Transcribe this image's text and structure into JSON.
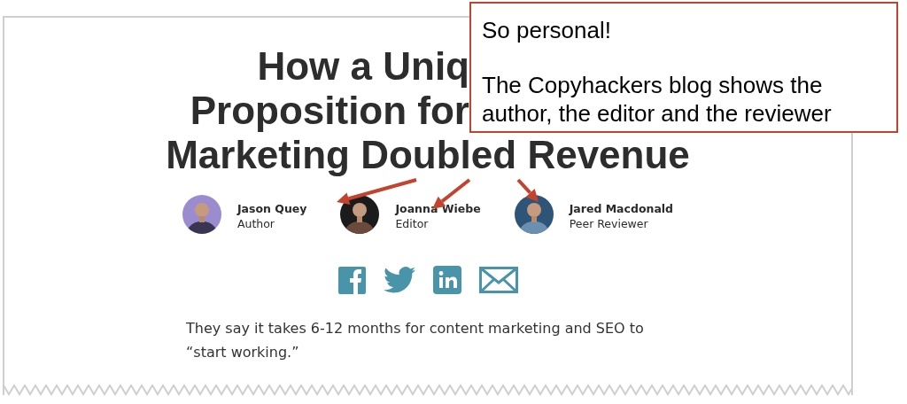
{
  "article": {
    "title_lines": [
      {
        "text": "How a Uniq",
        "cut": true
      },
      {
        "text": "Proposition for",
        "cut": true
      },
      {
        "text": "Marketing Doubled Revenue",
        "cut": false
      }
    ],
    "authors": [
      {
        "name": "Jason Quey",
        "role": "Author"
      },
      {
        "name": "Joanna Wiebe",
        "role": "Editor"
      },
      {
        "name": "Jared Macdonald",
        "role": "Peer Reviewer"
      }
    ],
    "share_icons": [
      {
        "kind": "facebook"
      },
      {
        "kind": "twitter"
      },
      {
        "kind": "linkedin"
      },
      {
        "kind": "email"
      }
    ],
    "intro": "They say it takes 6-12 months for content marketing and SEO to “start working.”"
  },
  "callout": {
    "lines": [
      "So personal!",
      "The Copyhackers blog shows the author, the editor and the reviewer"
    ]
  }
}
